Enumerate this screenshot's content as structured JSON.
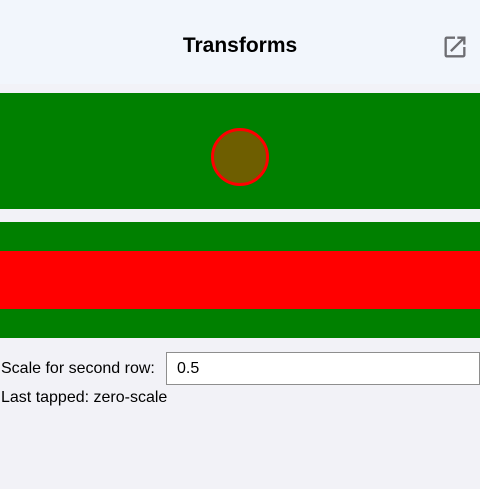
{
  "header": {
    "title": "Transforms",
    "action_icon": "open-in-new-icon"
  },
  "colors": {
    "row_background": "#008000",
    "circle_fill": "#6e5e00",
    "circle_stroke": "#ff0000",
    "band_fill": "#ff0000"
  },
  "controls": {
    "scale_label": "Scale for second row:",
    "scale_value": "0.5",
    "last_tapped": "Last tapped: zero-scale"
  }
}
